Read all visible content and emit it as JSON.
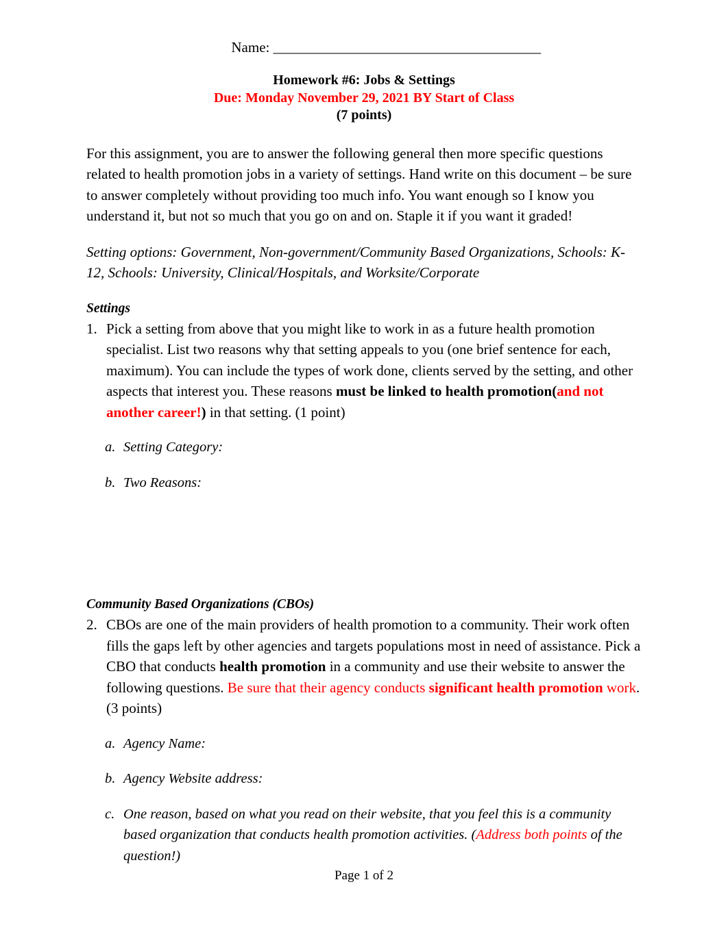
{
  "document": {
    "name_field": {
      "label": "Name:",
      "rule": "_______________________________________"
    },
    "title": {
      "line1": "Homework #6: Jobs & Settings",
      "line2": "Due: Monday November 29, 2021 BY Start of Class",
      "line3": "(7 points)",
      "due_color": "#FF0000"
    },
    "intro_paragraph": "For this assignment, you are to answer the following general then more specific questions related to health promotion jobs in a variety of settings. Hand write on this document – be sure to answer completely without providing too much info. You want enough so I know you understand it, but not so much that you go on and on. Staple it if you want it graded!",
    "setting_options_paragraph": "Setting options: Government, Non-government/Community Based Organizations, Schools: K-12, Schools: University, Clinical/Hospitals, and Worksite/Corporate",
    "sections": [
      {
        "heading": "Settings",
        "question": {
          "marker": "1.",
          "text_part1": "Pick a setting from above that you might like to work in as a future health promotion specialist. List two reasons why that setting appeals to you (one brief sentence for each, maximum). You can include the types of work done, clients served by the setting, and other aspects that interest you. These reasons ",
          "bold_black": "must be linked to health promotion",
          "open_paren": "(",
          "red_bold": "and not another career!",
          "close_paren": ")",
          "text_part2": " in that setting. (1 point)"
        },
        "subitems": [
          {
            "marker": "a.",
            "text": "Setting Category:"
          },
          {
            "marker": "b.",
            "text": "Two Reasons:"
          }
        ]
      },
      {
        "heading": "Community Based Organizations (CBOs)",
        "question": {
          "marker": "2.",
          "text_part1": "CBOs are one of the main providers of health promotion to a community. Their work often fills the gaps left by other agencies and targets populations most in need of assistance. Pick a CBO that conducts ",
          "bold_black": "health promotion",
          "text_part2": " in a community and use their website to answer the following questions. ",
          "red_plain1": "Be sure that their agency conducts ",
          "red_bold": "significant health promotion",
          "red_plain2": " work",
          "text_part3": ". (3 points)"
        },
        "subitems": [
          {
            "marker": "a.",
            "text": "Agency Name:"
          },
          {
            "marker": "b.",
            "text": "Agency Website address:"
          },
          {
            "marker": "c.",
            "text_part1": "One reason, based on what you read on their website, that you feel this is a community based organization that conducts health promotion activities. (",
            "red_italic": "Address both points",
            "text_part2": " of the question!)"
          }
        ]
      }
    ],
    "footer": "Page 1 of 2"
  }
}
